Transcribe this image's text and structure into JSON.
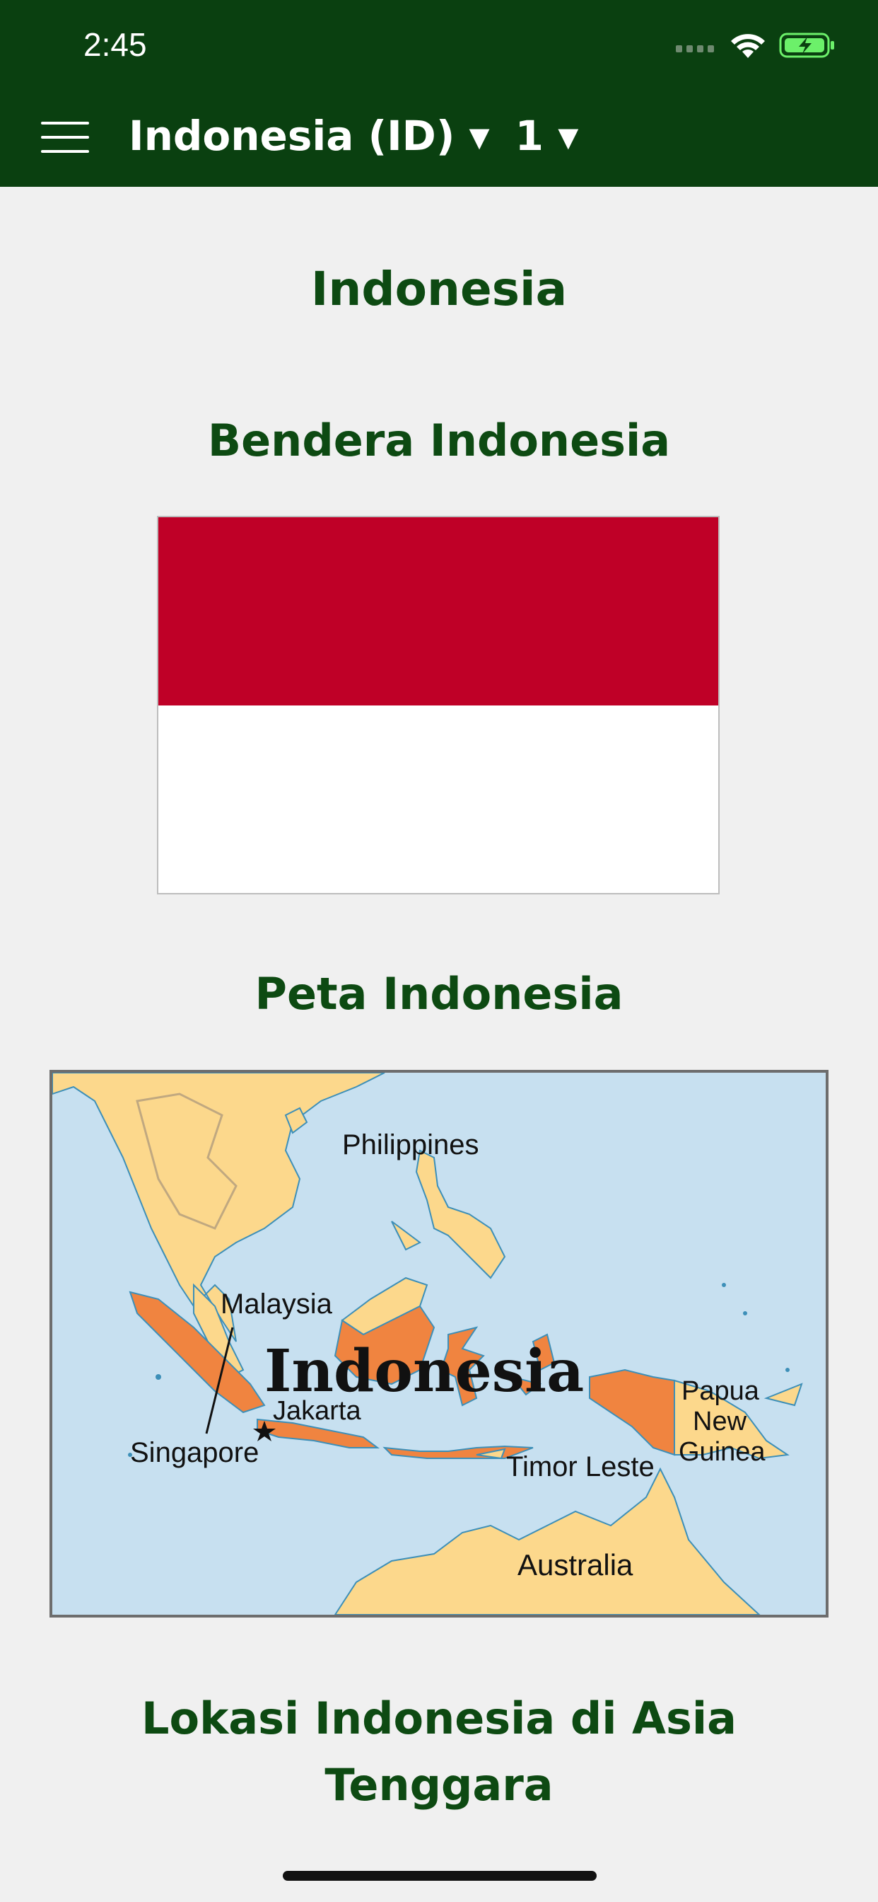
{
  "status_bar": {
    "time": "2:45"
  },
  "header": {
    "country_selector": "Indonesia (ID) ▾",
    "page_selector": "1 ▾"
  },
  "main": {
    "page_title": "Indonesia",
    "flag_section_title": "Bendera Indonesia",
    "map_section_title": "Peta Indonesia",
    "location_section_title": "Lokasi Indonesia di Asia Tenggara"
  },
  "map": {
    "labels": {
      "philippines": "Philippines",
      "malaysia": "Malaysia",
      "indonesia": "Indonesia",
      "jakarta": "Jakarta",
      "singapore": "Singapore",
      "papua": "Papua",
      "new": "New",
      "guinea": "Guinea",
      "timor": "Timor Leste",
      "australia": "Australia"
    }
  },
  "colors": {
    "appbar": "#0a4010",
    "heading": "#0d4a12",
    "flag_red": "#bf0027",
    "map_sea": "#c7e0f0",
    "map_land": "#fcd88c",
    "map_indonesia": "#f08440"
  }
}
